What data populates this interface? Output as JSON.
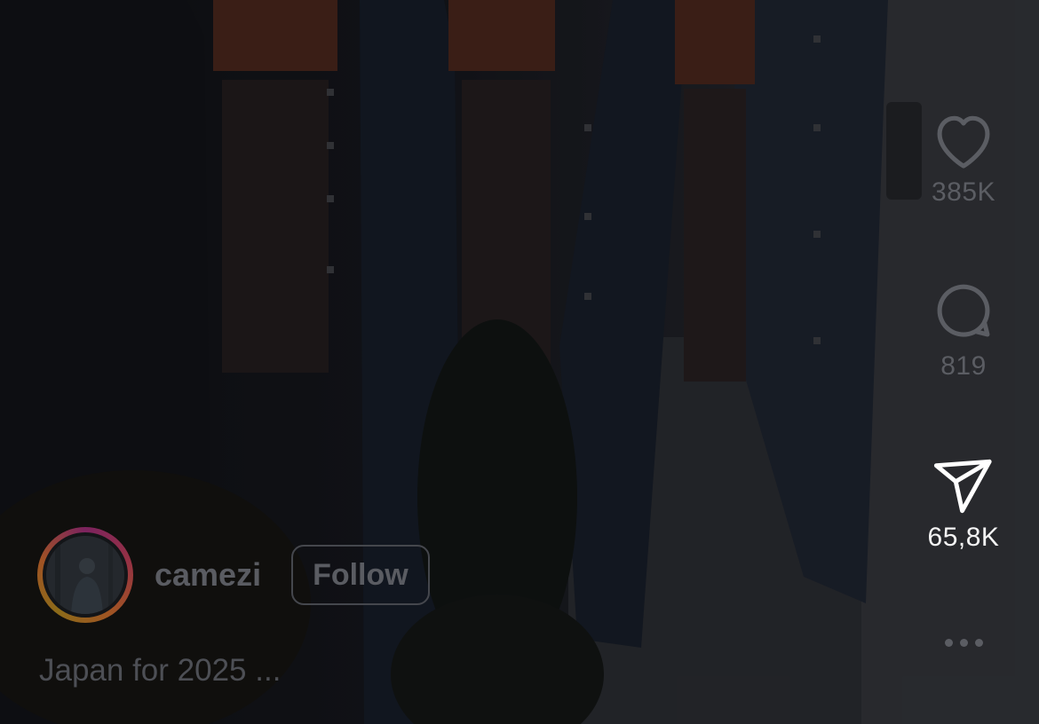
{
  "reel": {
    "author": {
      "username": "camezi",
      "follow_label": "Follow"
    },
    "caption": "Japan for 2025 ...",
    "actions": {
      "likes_count": "385K",
      "comments_count": "819",
      "shares_count": "65,8K",
      "more_icon": "more-horizontal-icon"
    }
  },
  "colors": {
    "dim_text": "#5b5d63",
    "bright_text": "#f4f4f4"
  }
}
